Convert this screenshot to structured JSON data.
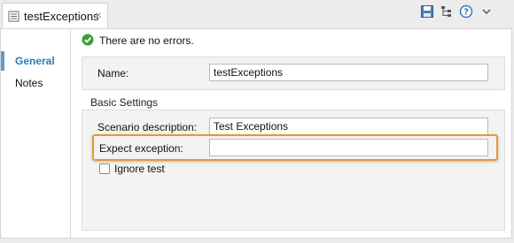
{
  "tab": {
    "title": "testExceptions",
    "close": "×"
  },
  "toolbar": {
    "icons": [
      "save-icon",
      "tree-icon",
      "help-icon",
      "chevron-down-icon"
    ]
  },
  "sidenav": {
    "items": [
      {
        "label": "General"
      },
      {
        "label": "Notes"
      }
    ]
  },
  "status": {
    "text": "There are no errors."
  },
  "form": {
    "name_label": "Name:",
    "name_value": "testExceptions",
    "section_title": "Basic Settings",
    "scenario_label": "Scenario description:",
    "scenario_value": "Test Exceptions",
    "expect_label": "Expect exception:",
    "expect_value": "",
    "ignore_label": "Ignore test"
  },
  "colors": {
    "accent": "#2a7db8",
    "highlight": "#e39b2e",
    "ok": "#3aa236"
  }
}
